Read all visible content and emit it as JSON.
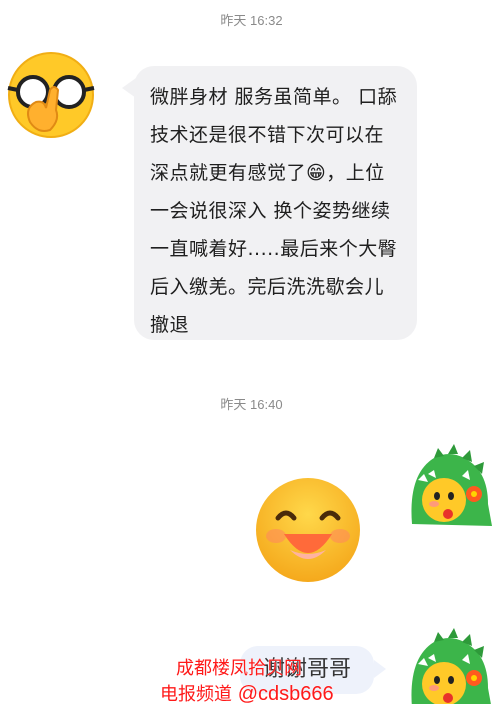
{
  "chat": {
    "timestamp_1": "昨天 16:32",
    "timestamp_2": "昨天 16:40",
    "message_1": "微胖身材 服务虽简单。 口舔技术还是很不错下次可以在深点就更有感觉了😁，上位一会说很深入 换个姿势继续 一直喊着好.....最后来个大臀后入缴羌。完后洗洗歇会儿撤退",
    "message_3": "谢谢哥哥"
  },
  "watermark": {
    "line_1": "成都楼凤拾贝网",
    "line_2_prefix": "电报频道 ",
    "line_2_handle": "@cdsb666"
  },
  "colors": {
    "bubble_bg": "#f1f1f3",
    "timestamp": "#8a8a8a",
    "watermark": "#ff1a1a",
    "emoji_yellow": "#ffc928"
  }
}
